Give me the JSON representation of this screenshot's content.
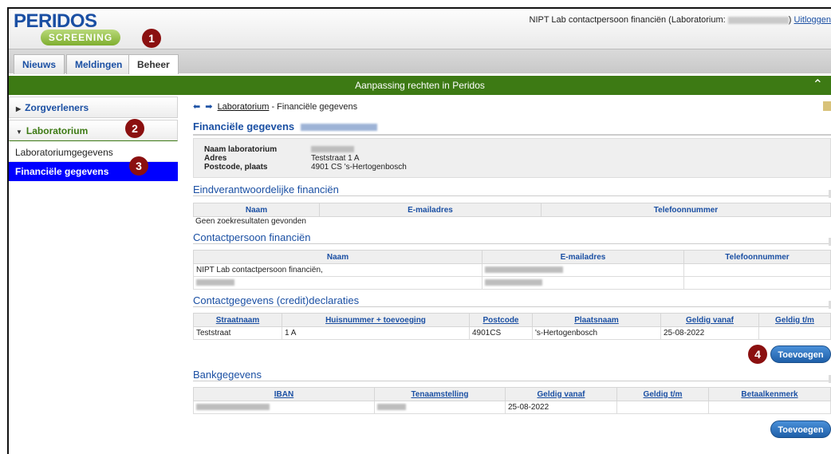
{
  "app": {
    "logo_top": "PERIDOS",
    "logo_bottom": "SCREENING",
    "user_prefix": "NIPT Lab contactpersoon financiën (Laboratorium:",
    "user_suffix": ")",
    "logout": "Uitloggen"
  },
  "tabs": [
    {
      "label": "Nieuws"
    },
    {
      "label": "Meldingen"
    },
    {
      "label": "Beheer",
      "active": true
    }
  ],
  "titlebar": {
    "title": "Aanpassing rechten in Peridos",
    "collapse_icon": "chevron-up-icon"
  },
  "sidebar": {
    "items": [
      {
        "label": "Zorgverleners"
      },
      {
        "label": "Laboratorium",
        "open": true
      }
    ],
    "subitems": [
      {
        "label": "Laboratoriumgegevens"
      },
      {
        "label": "Financiële gegevens",
        "selected": true
      }
    ]
  },
  "badges": [
    "1",
    "2",
    "3",
    "4"
  ],
  "breadcrumb": {
    "link": "Laboratorium",
    "rest": " - Financiële gegevens"
  },
  "page_title": "Financiële gegevens",
  "lab_info": {
    "name_label": "Naam laboratorium",
    "address_label": "Adres",
    "address_value": "Teststraat 1 A",
    "postcode_label": "Postcode, plaats",
    "postcode_value": "4901 CS  's-Hertogenbosch"
  },
  "eindverantwoordelijke": {
    "title": "Eindverantwoordelijke financiën",
    "columns": [
      "Naam",
      "E-mailadres",
      "Telefoonnummer"
    ],
    "empty_text": "Geen zoekresultaten gevonden"
  },
  "contactpersoon": {
    "title": "Contactpersoon financiën",
    "columns": [
      "Naam",
      "E-mailadres",
      "Telefoonnummer"
    ],
    "rows": [
      {
        "naam": "NIPT Lab contactpersoon financiën,"
      }
    ]
  },
  "declaraties": {
    "title": "Contactgegevens (credit)declaraties",
    "columns": [
      "Straatnaam",
      "Huisnummer + toevoeging",
      "Postcode",
      "Plaatsnaam",
      "Geldig vanaf",
      "Geldig t/m"
    ],
    "rows": [
      {
        "straatnaam": "Teststraat",
        "huisnummer": "1 A",
        "postcode": "4901CS",
        "plaatsnaam": "'s-Hertogenbosch",
        "vanaf": "25-08-2022",
        "tm": ""
      }
    ],
    "add_button": "Toevoegen"
  },
  "bank": {
    "title": "Bankgegevens",
    "columns": [
      "IBAN",
      "Tenaamstelling",
      "Geldig vanaf",
      "Geldig t/m",
      "Betaalkenmerk"
    ],
    "rows": [
      {
        "vanaf": "25-08-2022"
      }
    ],
    "add_button": "Toevoegen"
  },
  "colors": {
    "brand_blue": "#1a4fa3",
    "green_bar": "#3d7a14",
    "selected_blue": "#0000ff",
    "badge_red": "#8b1010"
  }
}
